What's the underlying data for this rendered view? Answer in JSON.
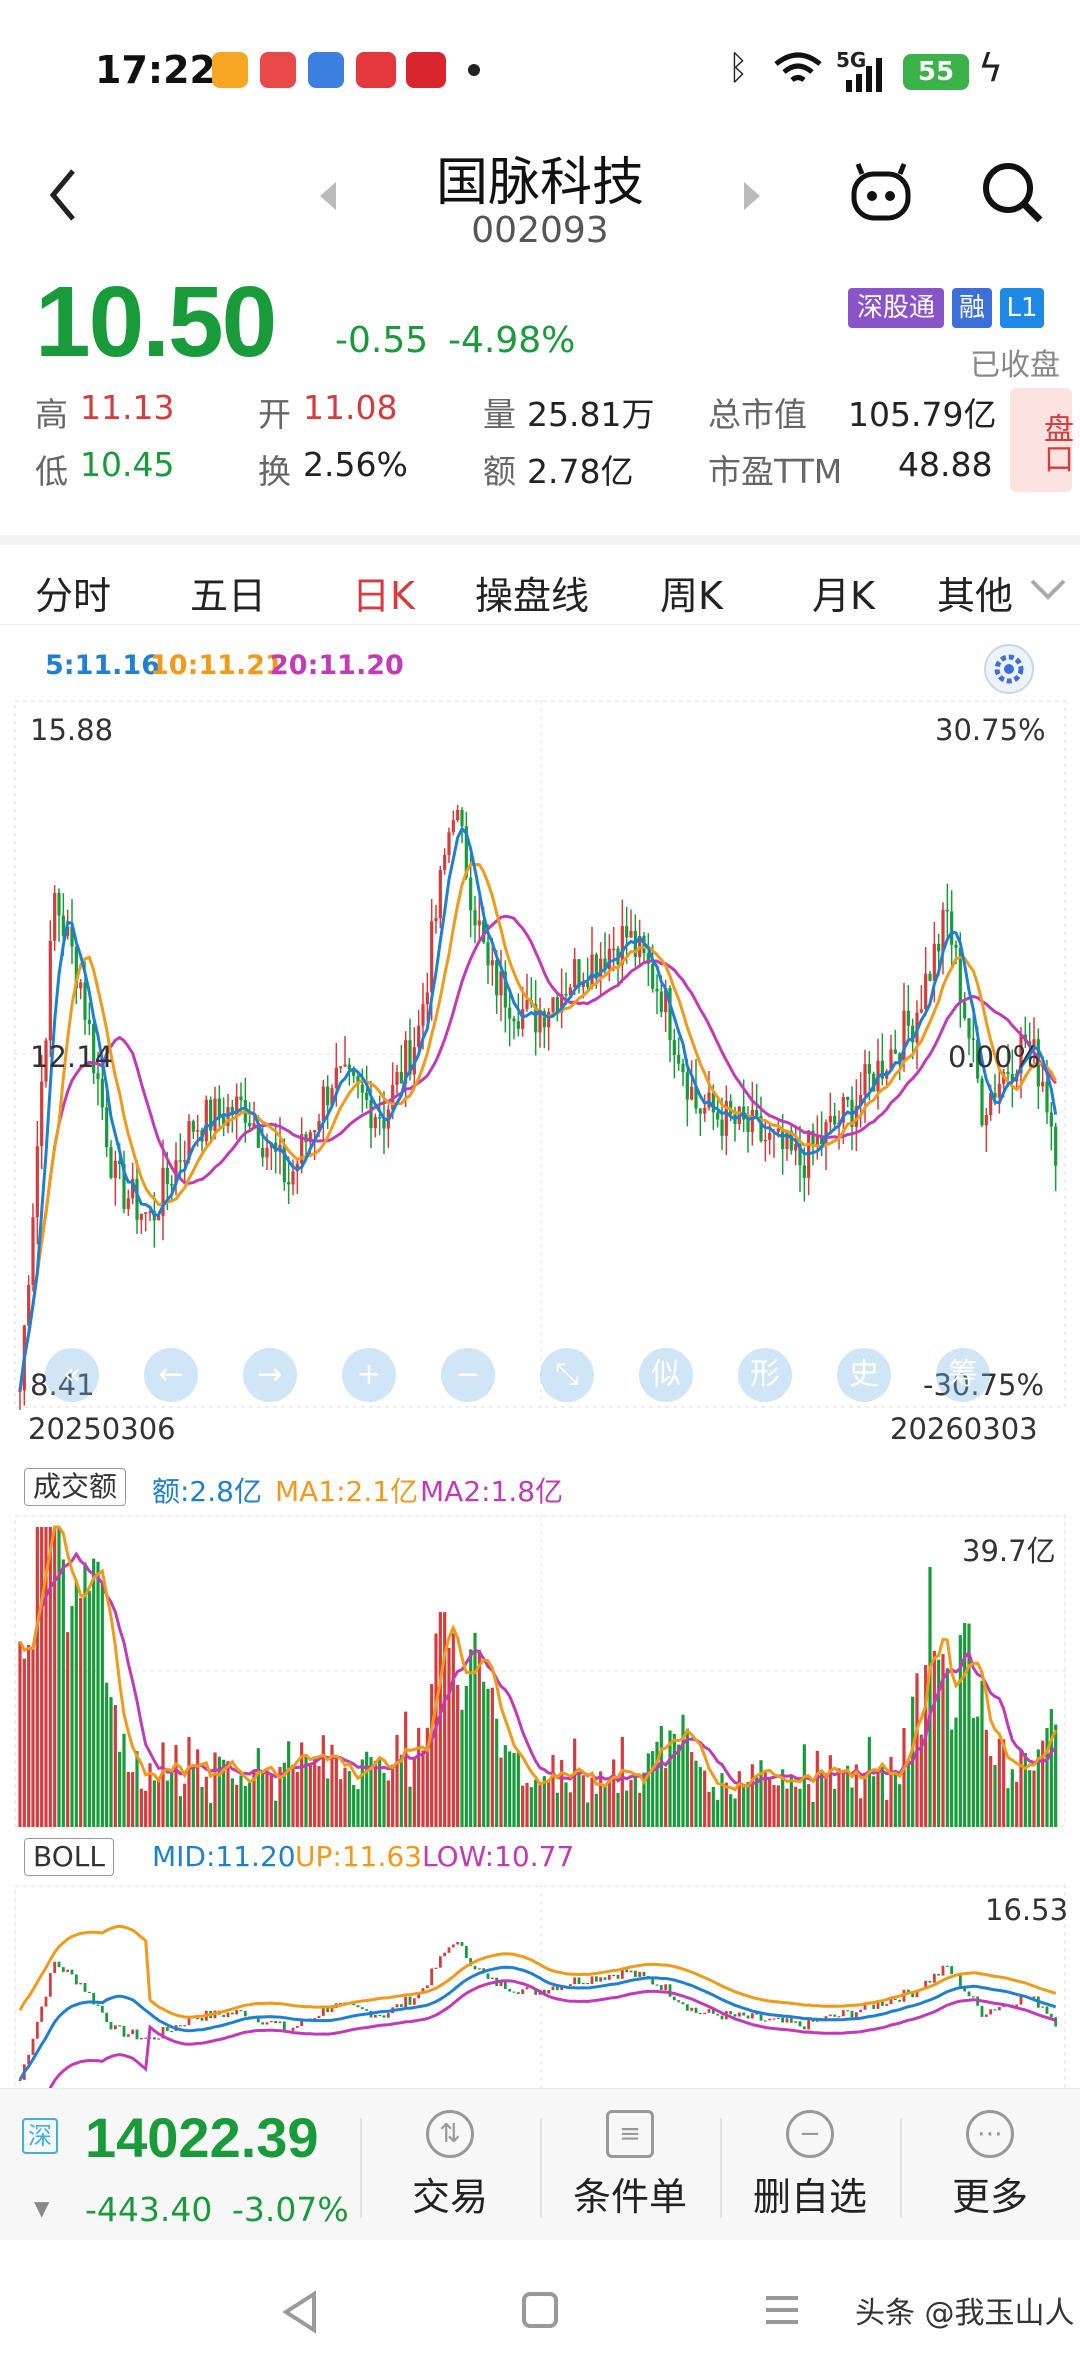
{
  "status_bar": {
    "time": "17:22",
    "network": "5G",
    "battery": "55"
  },
  "header": {
    "name": "国脉科技",
    "code": "002093"
  },
  "quote": {
    "price": "10.50",
    "change": "-0.55",
    "change_pct": "-4.98%",
    "badges": [
      "深股通",
      "融",
      "L1"
    ],
    "market_state": "已收盘",
    "high_label": "高",
    "high": "11.13",
    "open_label": "开",
    "open": "11.08",
    "vol_label": "量",
    "vol": "25.81万",
    "mcap_label": "总市值",
    "mcap": "105.79亿",
    "low_label": "低",
    "low": "10.45",
    "turnover_label": "换",
    "turnover": "2.56%",
    "amount_label": "额",
    "amount": "2.78亿",
    "pe_label": "市盈TTM",
    "pe": "48.88",
    "pankou": "盘口"
  },
  "tabs": [
    "分时",
    "五日",
    "日K",
    "操盘线",
    "周K",
    "月K",
    "其他"
  ],
  "active_tab": "日K",
  "ma_legend": {
    "ma5": "5:11.16",
    "ma10": "10:11.21",
    "ma20": "20:11.20"
  },
  "kline": {
    "high_label": "15.88",
    "mid_label": "12.14",
    "low_label": "8.41",
    "pct_top": "30.75%",
    "pct_mid": "0.00%",
    "pct_bottom": "-30.75%",
    "date_start": "20250306",
    "date_end": "20260303"
  },
  "toolbar_icons": [
    "«",
    "←",
    "→",
    "+",
    "−",
    "⤡",
    "似",
    "形",
    "史",
    "筹"
  ],
  "volume_panel": {
    "title": "成交额",
    "amount": "额:2.8亿",
    "ma1": "MA1:2.1亿",
    "ma2": "MA2:1.8亿",
    "max": "39.7亿"
  },
  "boll_panel": {
    "title": "BOLL",
    "mid": "MID:11.20",
    "up": "UP:11.63",
    "low": "LOW:10.77",
    "max": "16.53"
  },
  "index_bar": {
    "market": "深",
    "value": "14022.39",
    "change": "-443.40",
    "change_pct": "-3.07%"
  },
  "actions": [
    "交易",
    "条件单",
    "删自选",
    "更多"
  ],
  "watermark": "头条 @我玉山人",
  "colors": {
    "up": "#d33d3d",
    "down": "#1a9b3b",
    "ma5": "#1f7fd1",
    "ma10": "#ef9a1a",
    "ma20": "#c03bb5"
  }
}
